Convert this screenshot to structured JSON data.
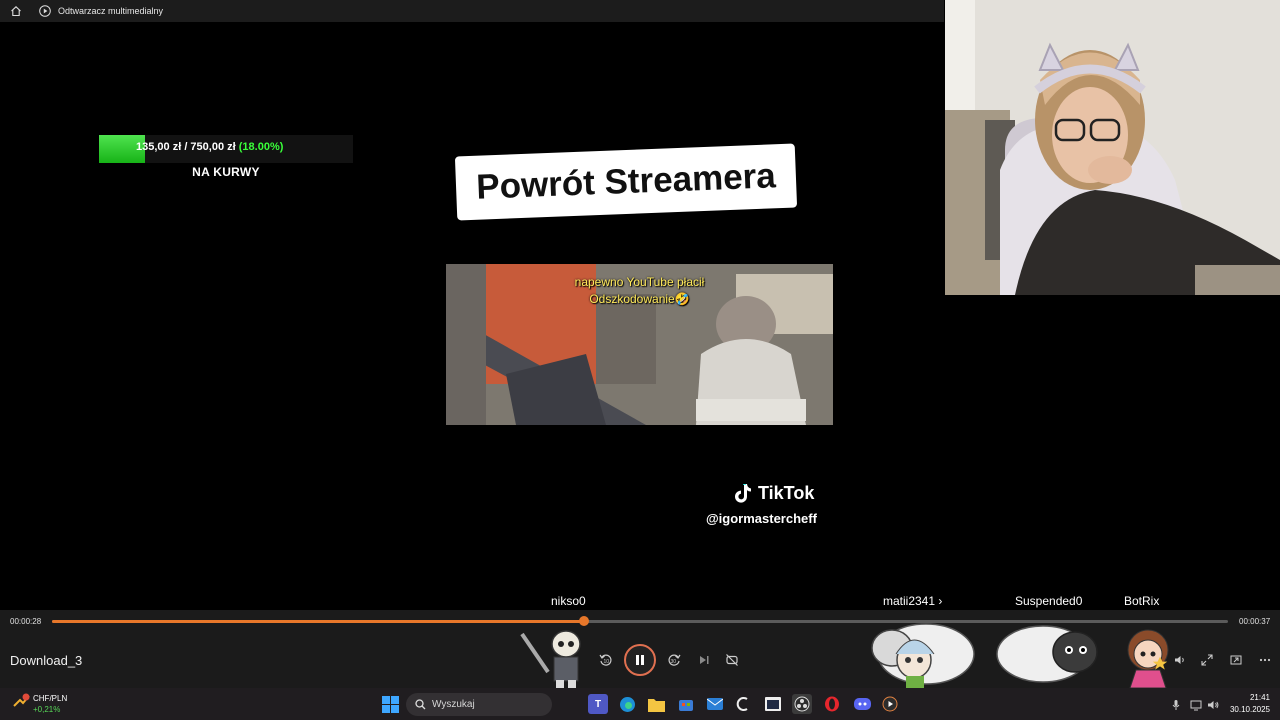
{
  "window": {
    "title": "Odtwarzacz multimedialny"
  },
  "overlay": {
    "donation": {
      "text": "135,00 zł / 750,00 zł",
      "percent_text": "(18.00%)",
      "progress": 0.18,
      "label": "NA KURWY"
    },
    "banner": "Powrót Streamera",
    "clip_caption_line1": "napewno YouTube płacił",
    "clip_caption_line2": "Odszkodowanie🤣",
    "tiktok_brand": "TikTok",
    "tiktok_handle": "@igormastercheff"
  },
  "chatters": [
    "nikso0",
    "matii2341 ›",
    "Suspended0",
    "BotRix"
  ],
  "player": {
    "current_time": "00:00:28",
    "total_time": "00:00:37",
    "progress": 0.4524,
    "filename": "Download_3",
    "accent_color": "#e7772a",
    "controls": [
      "rewind-10-icon",
      "pause-icon",
      "forward-30-icon",
      "next-icon",
      "repeat-off-icon",
      "volume-icon",
      "fullscreen-icon",
      "miniplayer-icon",
      "more-icon"
    ]
  },
  "taskbar": {
    "weather_label": "CHF/PLN",
    "weather_change": "+0,21%",
    "search_placeholder": "Wyszukaj",
    "time": "21:41",
    "date": "30.10.2025"
  }
}
